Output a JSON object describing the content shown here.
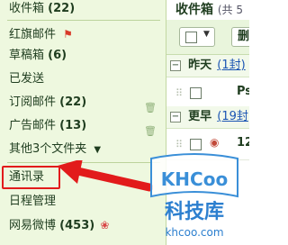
{
  "sidebar": {
    "items": [
      {
        "label": "收件箱",
        "count": "(22)"
      },
      {
        "label": "红旗邮件"
      },
      {
        "label": "草稿箱",
        "count": "(6)"
      },
      {
        "label": "已发送"
      },
      {
        "label": "订阅邮件",
        "count": "(22)"
      },
      {
        "label": "广告邮件",
        "count": "(13)"
      },
      {
        "label": "其他3个文件夹"
      },
      {
        "label": "通讯录"
      },
      {
        "label": "日程管理"
      },
      {
        "label": "网易微博",
        "count": "(453)"
      }
    ]
  },
  "main": {
    "title": "收件箱",
    "title_suffix": "(共 5",
    "toolbar": {
      "delete_label": "删"
    },
    "groups": [
      {
        "label": "昨天",
        "link": "(1封)"
      },
      {
        "label": "更早",
        "link": "(19封"
      }
    ],
    "rows": [
      {
        "text": "Ps"
      },
      {
        "text": "12"
      }
    ]
  },
  "watermark": {
    "logo_text": "KHCoo",
    "cn_text": "科技库",
    "domain": "khcoo.com"
  },
  "colors": {
    "sidebar_bg": "#eef8df",
    "highlight": "#e21b1b",
    "link": "#1b55b3"
  }
}
